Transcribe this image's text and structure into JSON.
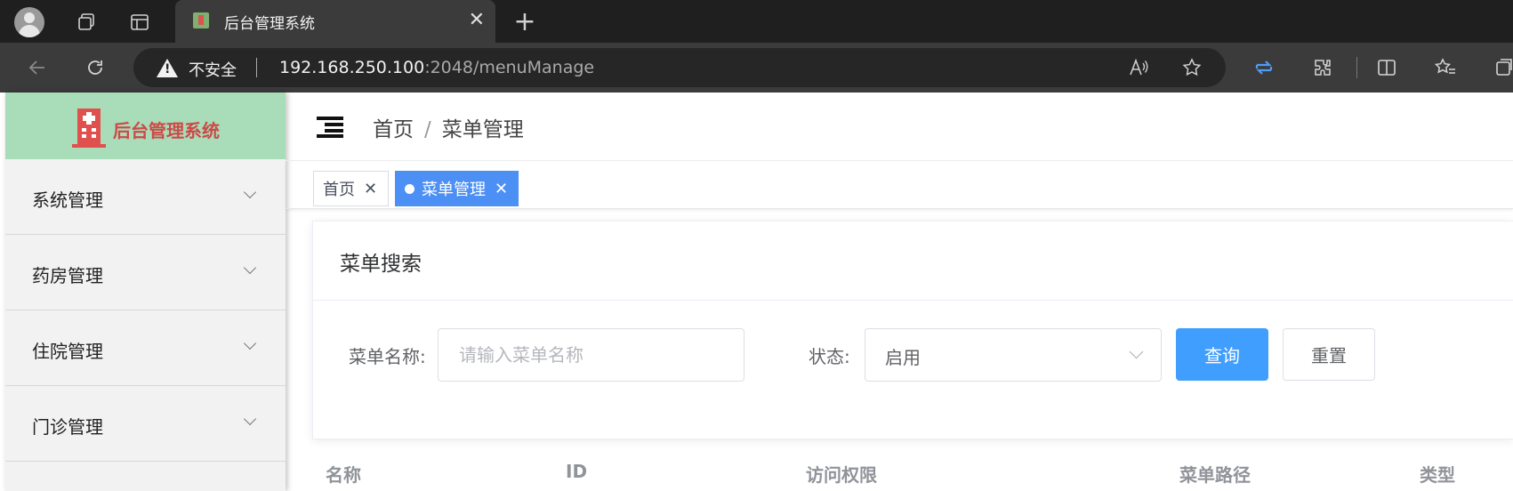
{
  "browser": {
    "tab_title": "后台管理系统",
    "tab_close": "✕",
    "new_tab": "+",
    "security_label": "不安全",
    "url_host": "192.168.250.100",
    "url_rest": ":2048/menuManage"
  },
  "app": {
    "logo_text": "后台管理系统",
    "colors": {
      "logo_bg": "#a9dcb8",
      "logo_text": "#cc4a48",
      "primary": "#409eff",
      "active_tag": "#4c8ff5"
    }
  },
  "sidebar": {
    "items": [
      {
        "label": "系统管理"
      },
      {
        "label": "药房管理"
      },
      {
        "label": "住院管理"
      },
      {
        "label": "门诊管理"
      }
    ]
  },
  "header": {
    "breadcrumb": [
      "首页",
      "菜单管理"
    ],
    "separator": "/"
  },
  "tags": {
    "home": "首页",
    "active": "菜单管理",
    "close": "✕"
  },
  "search": {
    "title": "菜单搜索",
    "name_label": "菜单名称:",
    "name_placeholder": "请输入菜单名称",
    "status_label": "状态:",
    "status_value": "启用",
    "query_button": "查询",
    "reset_button": "重置"
  },
  "table": {
    "columns": [
      "名称",
      "ID",
      "访问权限",
      "菜单路径",
      "类型"
    ]
  }
}
